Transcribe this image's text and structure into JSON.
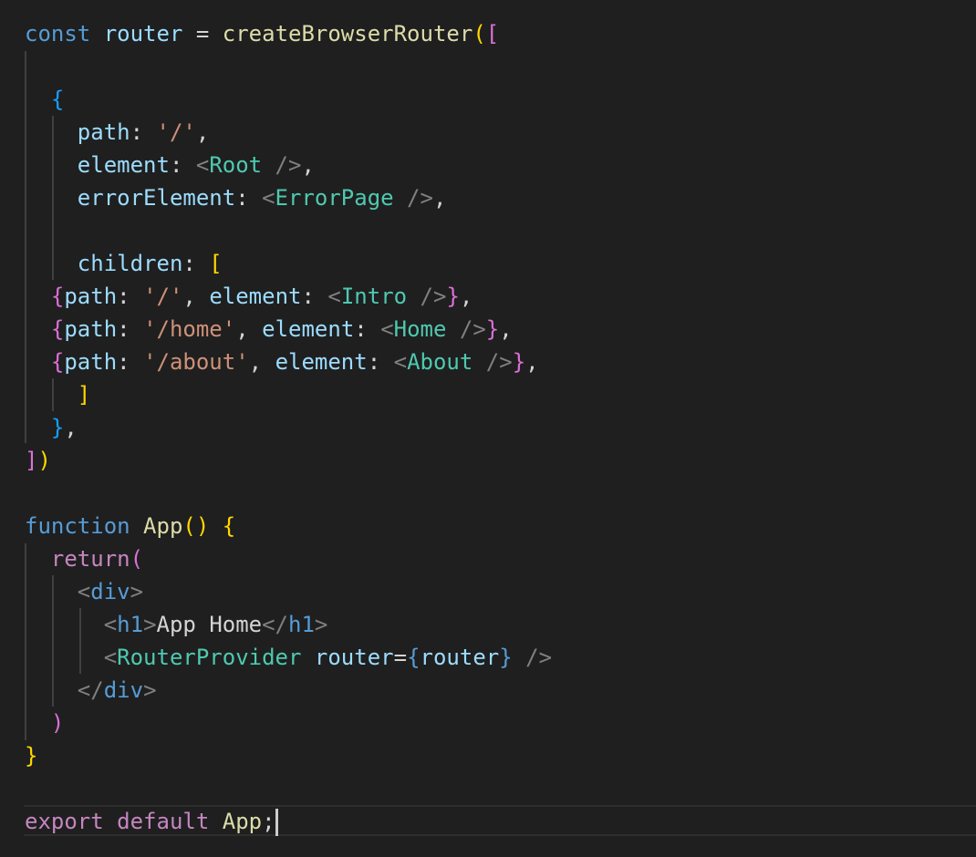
{
  "colors": {
    "background": "#1f1f1f",
    "keyword_blue": "#569cd6",
    "keyword_purple": "#c586c0",
    "variable": "#9cdcfe",
    "function": "#dcdcaa",
    "string": "#ce9178",
    "component": "#4ec9b0",
    "punctuation": "#d4d4d4",
    "tag_bracket": "#808080",
    "bracket_gold": "#ffd700",
    "bracket_purple": "#da70d6",
    "bracket_blue": "#179fff"
  },
  "code": {
    "lines": [
      [
        [
          "const",
          "#569cd6"
        ],
        [
          " ",
          "#d4d4d4"
        ],
        [
          "router",
          "#9cdcfe"
        ],
        [
          " = ",
          "#d4d4d4"
        ],
        [
          "createBrowserRouter",
          "#dcdcaa"
        ],
        [
          "(",
          "#ffd700"
        ],
        [
          "[",
          "#da70d6"
        ]
      ],
      [],
      [
        [
          "  ",
          "#d4d4d4"
        ],
        [
          "{",
          "#179fff"
        ]
      ],
      [
        [
          "    ",
          "#d4d4d4"
        ],
        [
          "path",
          "#9cdcfe"
        ],
        [
          ": ",
          "#d4d4d4"
        ],
        [
          "'/'",
          "#ce9178"
        ],
        [
          ",",
          "#d4d4d4"
        ]
      ],
      [
        [
          "    ",
          "#d4d4d4"
        ],
        [
          "element",
          "#9cdcfe"
        ],
        [
          ": ",
          "#d4d4d4"
        ],
        [
          "<",
          "#808080"
        ],
        [
          "Root",
          "#4ec9b0"
        ],
        [
          " />",
          "#808080"
        ],
        [
          ",",
          "#d4d4d4"
        ]
      ],
      [
        [
          "    ",
          "#d4d4d4"
        ],
        [
          "errorElement",
          "#9cdcfe"
        ],
        [
          ": ",
          "#d4d4d4"
        ],
        [
          "<",
          "#808080"
        ],
        [
          "ErrorPage",
          "#4ec9b0"
        ],
        [
          " />",
          "#808080"
        ],
        [
          ",",
          "#d4d4d4"
        ]
      ],
      [],
      [
        [
          "    ",
          "#d4d4d4"
        ],
        [
          "children",
          "#9cdcfe"
        ],
        [
          ": ",
          "#d4d4d4"
        ],
        [
          "[",
          "#ffd700"
        ]
      ],
      [
        [
          "  ",
          "#d4d4d4"
        ],
        [
          "{",
          "#da70d6"
        ],
        [
          "path",
          "#9cdcfe"
        ],
        [
          ": ",
          "#d4d4d4"
        ],
        [
          "'/'",
          "#ce9178"
        ],
        [
          ", ",
          "#d4d4d4"
        ],
        [
          "element",
          "#9cdcfe"
        ],
        [
          ": ",
          "#d4d4d4"
        ],
        [
          "<",
          "#808080"
        ],
        [
          "Intro",
          "#4ec9b0"
        ],
        [
          " />",
          "#808080"
        ],
        [
          "}",
          "#da70d6"
        ],
        [
          ",",
          "#d4d4d4"
        ]
      ],
      [
        [
          "  ",
          "#d4d4d4"
        ],
        [
          "{",
          "#da70d6"
        ],
        [
          "path",
          "#9cdcfe"
        ],
        [
          ": ",
          "#d4d4d4"
        ],
        [
          "'/home'",
          "#ce9178"
        ],
        [
          ", ",
          "#d4d4d4"
        ],
        [
          "element",
          "#9cdcfe"
        ],
        [
          ": ",
          "#d4d4d4"
        ],
        [
          "<",
          "#808080"
        ],
        [
          "Home",
          "#4ec9b0"
        ],
        [
          " />",
          "#808080"
        ],
        [
          "}",
          "#da70d6"
        ],
        [
          ",",
          "#d4d4d4"
        ]
      ],
      [
        [
          "  ",
          "#d4d4d4"
        ],
        [
          "{",
          "#da70d6"
        ],
        [
          "path",
          "#9cdcfe"
        ],
        [
          ": ",
          "#d4d4d4"
        ],
        [
          "'/about'",
          "#ce9178"
        ],
        [
          ", ",
          "#d4d4d4"
        ],
        [
          "element",
          "#9cdcfe"
        ],
        [
          ": ",
          "#d4d4d4"
        ],
        [
          "<",
          "#808080"
        ],
        [
          "About",
          "#4ec9b0"
        ],
        [
          " />",
          "#808080"
        ],
        [
          "}",
          "#da70d6"
        ],
        [
          ",",
          "#d4d4d4"
        ]
      ],
      [
        [
          "    ",
          "#d4d4d4"
        ],
        [
          "]",
          "#ffd700"
        ]
      ],
      [
        [
          "  ",
          "#d4d4d4"
        ],
        [
          "}",
          "#179fff"
        ],
        [
          ",",
          "#d4d4d4"
        ]
      ],
      [
        [
          "]",
          "#da70d6"
        ],
        [
          ")",
          "#ffd700"
        ]
      ],
      [],
      [
        [
          "function",
          "#569cd6"
        ],
        [
          " ",
          "#d4d4d4"
        ],
        [
          "App",
          "#dcdcaa"
        ],
        [
          "()",
          "#ffd700"
        ],
        [
          " ",
          "#d4d4d4"
        ],
        [
          "{",
          "#ffd700"
        ]
      ],
      [
        [
          "  ",
          "#d4d4d4"
        ],
        [
          "return",
          "#c586c0"
        ],
        [
          "(",
          "#da70d6"
        ]
      ],
      [
        [
          "    ",
          "#d4d4d4"
        ],
        [
          "<",
          "#808080"
        ],
        [
          "div",
          "#569cd6"
        ],
        [
          ">",
          "#808080"
        ]
      ],
      [
        [
          "      ",
          "#d4d4d4"
        ],
        [
          "<",
          "#808080"
        ],
        [
          "h1",
          "#569cd6"
        ],
        [
          ">",
          "#808080"
        ],
        [
          "App Home",
          "#d4d4d4"
        ],
        [
          "</",
          "#808080"
        ],
        [
          "h1",
          "#569cd6"
        ],
        [
          ">",
          "#808080"
        ]
      ],
      [
        [
          "      ",
          "#d4d4d4"
        ],
        [
          "<",
          "#808080"
        ],
        [
          "RouterProvider",
          "#4ec9b0"
        ],
        [
          " ",
          "#d4d4d4"
        ],
        [
          "router",
          "#9cdcfe"
        ],
        [
          "=",
          "#d4d4d4"
        ],
        [
          "{",
          "#569cd6"
        ],
        [
          "router",
          "#9cdcfe"
        ],
        [
          "}",
          "#569cd6"
        ],
        [
          " />",
          "#808080"
        ]
      ],
      [
        [
          "    ",
          "#d4d4d4"
        ],
        [
          "</",
          "#808080"
        ],
        [
          "div",
          "#569cd6"
        ],
        [
          ">",
          "#808080"
        ]
      ],
      [
        [
          "  ",
          "#d4d4d4"
        ],
        [
          ")",
          "#da70d6"
        ]
      ],
      [
        [
          "}",
          "#ffd700"
        ]
      ],
      [],
      [
        [
          "export",
          "#c586c0"
        ],
        [
          " ",
          "#d4d4d4"
        ],
        [
          "default",
          "#c586c0"
        ],
        [
          " ",
          "#d4d4d4"
        ],
        [
          "App",
          "#dcdcaa"
        ],
        [
          ";",
          "#d4d4d4"
        ]
      ]
    ]
  }
}
